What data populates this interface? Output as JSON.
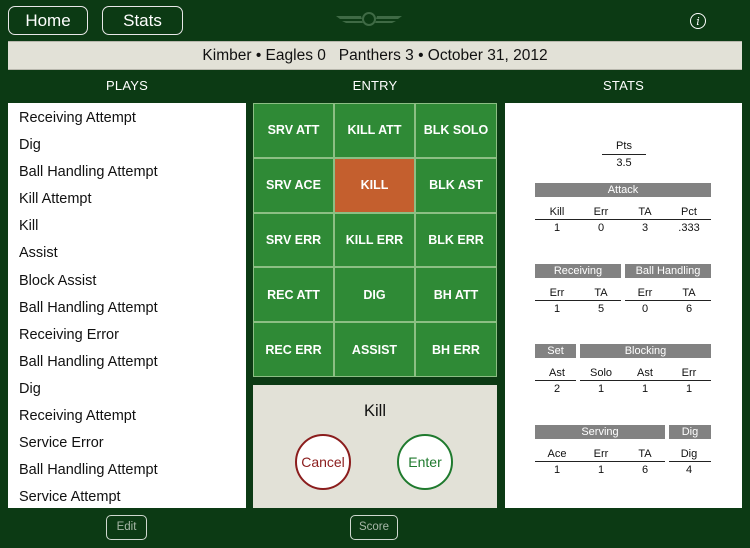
{
  "nav": {
    "home_label": "Home",
    "stats_label": "Stats",
    "info_label": "i"
  },
  "game": {
    "summary": "Kimber • Eagles 0   Panthers 3 • October 31, 2012"
  },
  "columns": {
    "plays": "PLAYS",
    "entry": "ENTRY",
    "stats": "STATS"
  },
  "plays": [
    "Receiving Attempt",
    "Dig",
    "Ball Handling Attempt",
    "Kill Attempt",
    "Kill",
    "Assist",
    "Block Assist",
    "Ball Handling Attempt",
    "Receiving Error",
    "Ball Handling Attempt",
    "Dig",
    "Receiving Attempt",
    "Service Error",
    "Ball Handling Attempt",
    "Service Attempt"
  ],
  "entry": {
    "buttons": [
      "SRV ATT",
      "KILL ATT",
      "BLK SOLO",
      "SRV ACE",
      "KILL",
      "BLK AST",
      "SRV ERR",
      "KILL ERR",
      "BLK ERR",
      "REC ATT",
      "DIG",
      "BH ATT",
      "REC ERR",
      "ASSIST",
      "BH ERR"
    ],
    "selected": "KILL",
    "selected_color": "#c45f2e",
    "button_color": "#2f8a36",
    "confirm_title": "Kill",
    "cancel_label": "Cancel",
    "enter_label": "Enter"
  },
  "stats": {
    "pts": {
      "label": "Pts",
      "value": "3.5"
    },
    "attack": {
      "title": "Attack",
      "headers": [
        "Kill",
        "Err",
        "TA",
        "Pct"
      ],
      "values": [
        "1",
        "0",
        "3",
        ".333"
      ]
    },
    "receiving": {
      "title": "Receiving",
      "headers": [
        "Err",
        "TA"
      ],
      "values": [
        "1",
        "5"
      ]
    },
    "ball_handling": {
      "title": "Ball Handling",
      "headers": [
        "Err",
        "TA"
      ],
      "values": [
        "0",
        "6"
      ]
    },
    "set": {
      "title": "Set",
      "headers": [
        "Ast"
      ],
      "values": [
        "2"
      ]
    },
    "blocking": {
      "title": "Blocking",
      "headers": [
        "Solo",
        "Ast",
        "Err"
      ],
      "values": [
        "1",
        "1",
        "1"
      ]
    },
    "serving": {
      "title": "Serving",
      "headers": [
        "Ace",
        "Err",
        "TA"
      ],
      "values": [
        "1",
        "1",
        "6"
      ]
    },
    "dig": {
      "title": "Dig",
      "headers": [
        "Dig"
      ],
      "values": [
        "4"
      ]
    }
  },
  "footer": {
    "edit_label": "Edit",
    "score_label": "Score"
  }
}
